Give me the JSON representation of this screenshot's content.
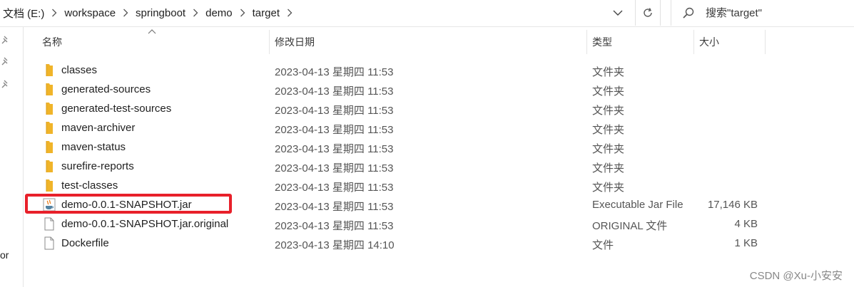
{
  "address": {
    "crumbs": [
      "文档 (E:)",
      "workspace",
      "springboot",
      "demo",
      "target"
    ]
  },
  "search": {
    "placeholder": "搜索\"target\""
  },
  "nav": {
    "cut_label": "or"
  },
  "columns": {
    "name": "名称",
    "date": "修改日期",
    "type": "类型",
    "size": "大小"
  },
  "files": [
    {
      "name": "classes",
      "date": "2023-04-13 星期四 11:53",
      "type": "文件夹",
      "size": "",
      "icon": "folder-icon"
    },
    {
      "name": "generated-sources",
      "date": "2023-04-13 星期四 11:53",
      "type": "文件夹",
      "size": "",
      "icon": "folder-icon"
    },
    {
      "name": "generated-test-sources",
      "date": "2023-04-13 星期四 11:53",
      "type": "文件夹",
      "size": "",
      "icon": "folder-icon"
    },
    {
      "name": "maven-archiver",
      "date": "2023-04-13 星期四 11:53",
      "type": "文件夹",
      "size": "",
      "icon": "folder-icon"
    },
    {
      "name": "maven-status",
      "date": "2023-04-13 星期四 11:53",
      "type": "文件夹",
      "size": "",
      "icon": "folder-icon"
    },
    {
      "name": "surefire-reports",
      "date": "2023-04-13 星期四 11:53",
      "type": "文件夹",
      "size": "",
      "icon": "folder-icon"
    },
    {
      "name": "test-classes",
      "date": "2023-04-13 星期四 11:53",
      "type": "文件夹",
      "size": "",
      "icon": "folder-icon"
    },
    {
      "name": "demo-0.0.1-SNAPSHOT.jar",
      "date": "2023-04-13 星期四 11:53",
      "type": "Executable Jar File",
      "size": "17,146 KB",
      "icon": "java-jar-icon"
    },
    {
      "name": "demo-0.0.1-SNAPSHOT.jar.original",
      "date": "2023-04-13 星期四 11:53",
      "type": "ORIGINAL 文件",
      "size": "4 KB",
      "icon": "file-icon"
    },
    {
      "name": "Dockerfile",
      "date": "2023-04-13 星期四 14:10",
      "type": "文件",
      "size": "1 KB",
      "icon": "file-icon"
    }
  ],
  "highlight_color": "#e8202a",
  "folder_color": "#f0b429",
  "watermark": "CSDN @Xu-小安安"
}
